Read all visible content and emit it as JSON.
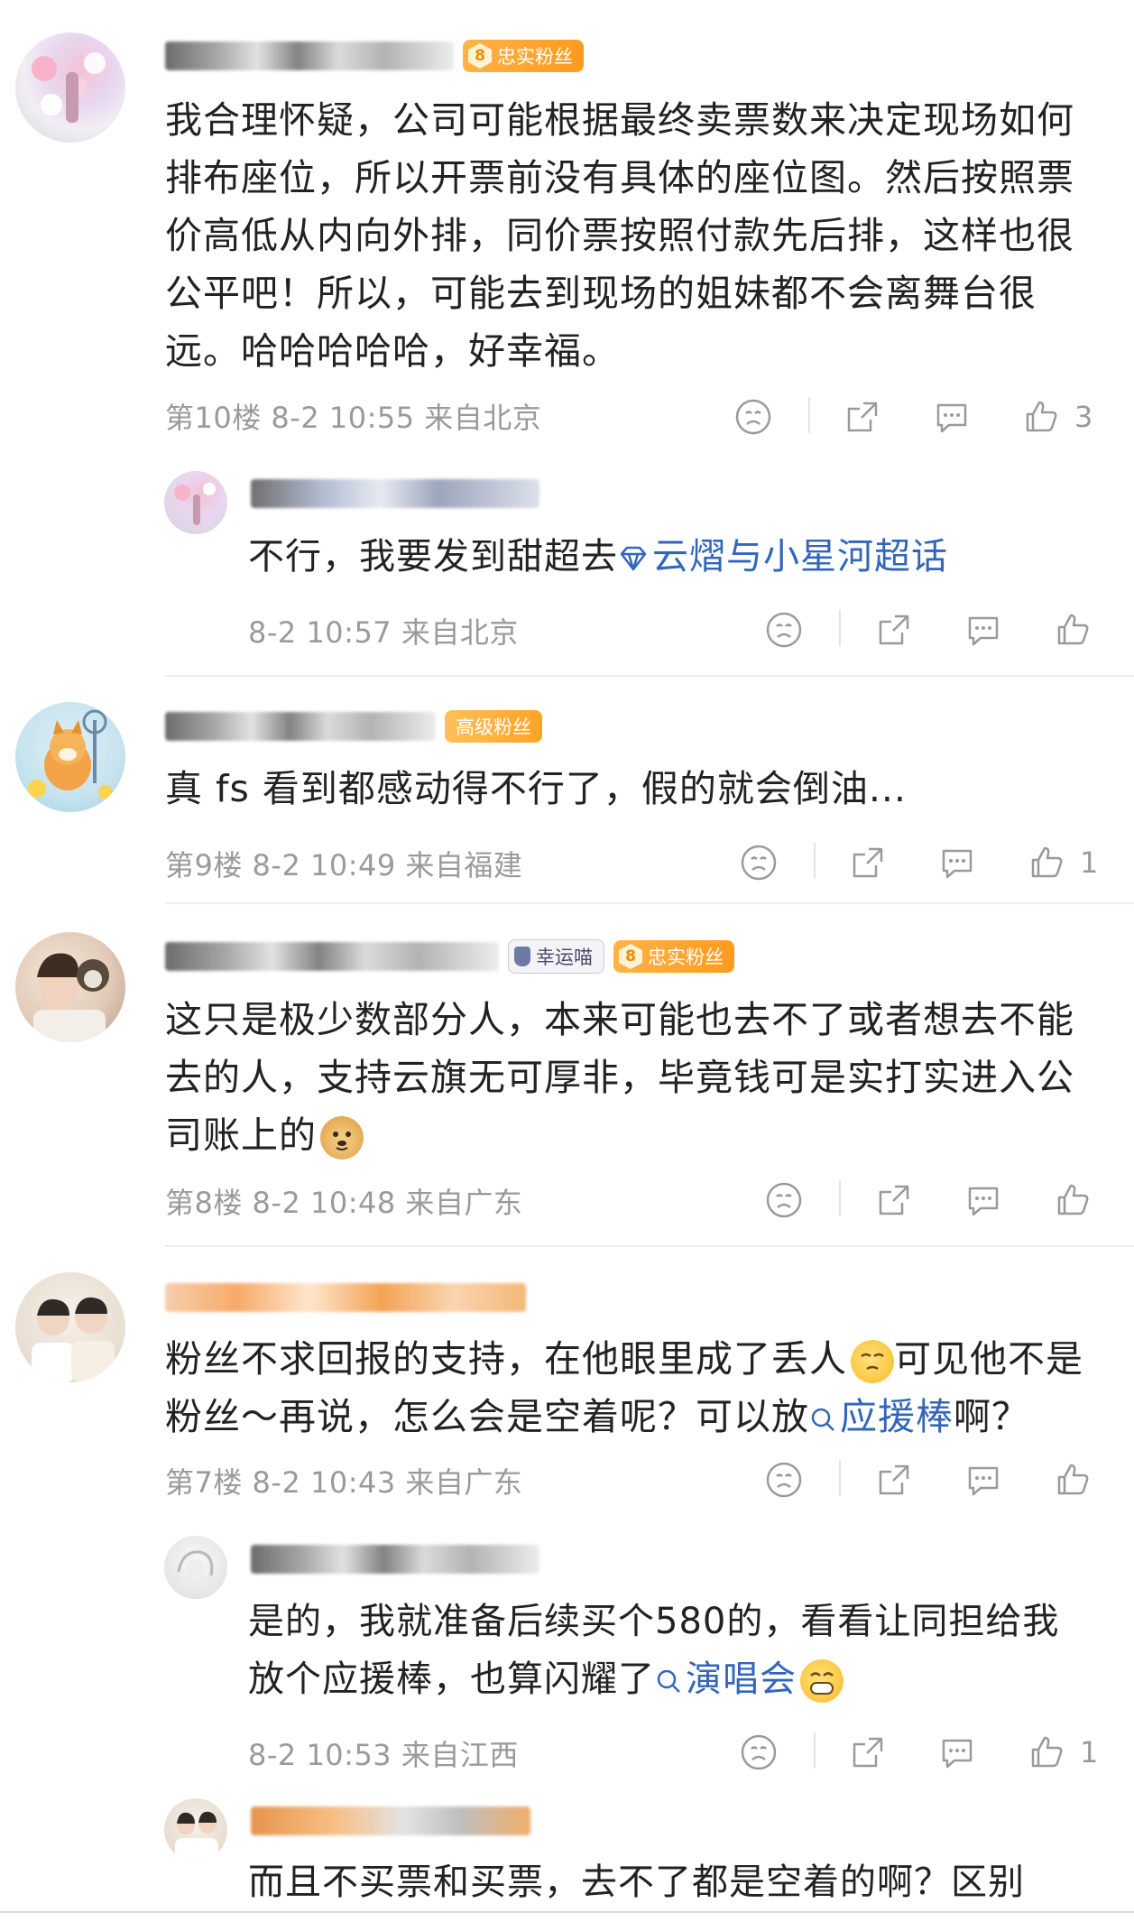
{
  "comments": [
    {
      "badge_level": "8",
      "badge_label": "忠实粉丝",
      "text": "我合理怀疑，公司可能根据最终卖票数来决定现场如何排布座位，所以开票前没有具体的座位图。然后按照票价高低从内向外排，同价票按照付款先后排，这样也很公平吧！所以，可能去到现场的姐妹都不会离舞台很远。哈哈哈哈哈，好幸福。",
      "floor": "第10楼",
      "time": "8-2 10:55",
      "location": "来自北京",
      "like_count": "3",
      "reply": {
        "text_before": "不行，我要发到甜超去",
        "topic_link": "云熠与小星河超话",
        "time": "8-2 10:57",
        "location": "来自北京"
      }
    },
    {
      "badge_label": "高级粉丝",
      "text": "真 fs 看到都感动得不行了，假的就会倒油...",
      "floor": "第9楼",
      "time": "8-2 10:49",
      "location": "来自福建",
      "like_count": "1"
    },
    {
      "lucky_badge": "幸运喵",
      "badge_level": "8",
      "badge_label": "忠实粉丝",
      "text": "这只是极少数部分人，本来可能也去不了或者想去不能去的人，支持云旗无可厚非，毕竟钱可是实打实进入公司账上的",
      "floor": "第8楼",
      "time": "8-2 10:48",
      "location": "来自广东"
    },
    {
      "text_part1": "粉丝不求回报的支持，在他眼里成了丢人",
      "text_part2": "可见他不是粉丝～再说，怎么会是空着呢？可以放",
      "search_link": "应援棒",
      "text_part3": "啊？",
      "floor": "第7楼",
      "time": "8-2 10:43",
      "location": "来自广东",
      "reply1": {
        "text_before": "是的，我就准备后续买个580的，看看让同担给我放个应援棒，也算闪耀了",
        "search_link": "演唱会",
        "time": "8-2 10:53",
        "location": "来自江西",
        "like_count": "1"
      },
      "reply2": {
        "text": "而且不买票和买票，去不了都是空着的啊？区别"
      }
    }
  ],
  "icons": [
    "dislike-icon",
    "share-icon",
    "comment-icon",
    "like-icon",
    "search-icon",
    "super-topic-icon"
  ],
  "colors": {
    "link": "#3366bb",
    "meta": "#9a9a9a",
    "badge": "#ff9a1f",
    "text": "#222222"
  }
}
